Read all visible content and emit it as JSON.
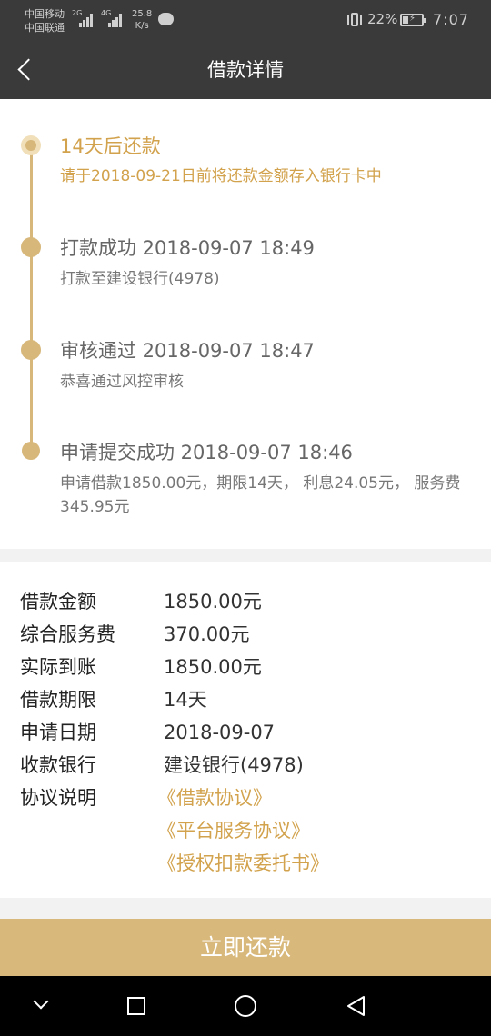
{
  "status_bar": {
    "carrier1": "中国移动",
    "carrier2": "中国联通",
    "net1": "2G",
    "net2": "4G",
    "speed_value": "25.8",
    "speed_unit": "K/s",
    "battery": "22%",
    "time": "7:07"
  },
  "header": {
    "title": "借款详情"
  },
  "timeline": [
    {
      "title": "14天后还款",
      "desc": "请于2018-09-21日前将还款金额存入银行卡中"
    },
    {
      "title": "打款成功 2018-09-07 18:49",
      "desc": "打款至建设银行(4978)"
    },
    {
      "title": "审核通过 2018-09-07 18:47",
      "desc": "恭喜通过风控审核"
    },
    {
      "title": "申请提交成功 2018-09-07 18:46",
      "desc": "申请借款1850.00元，期限14天， 利息24.05元， 服务费345.95元"
    }
  ],
  "details": [
    {
      "label": "借款金额",
      "value": "1850.00元"
    },
    {
      "label": "综合服务费",
      "value": "370.00元"
    },
    {
      "label": "实际到账",
      "value": "1850.00元"
    },
    {
      "label": "借款期限",
      "value": "14天"
    },
    {
      "label": "申请日期",
      "value": "2018-09-07"
    },
    {
      "label": "收款银行",
      "value": "建设银行(4978)"
    }
  ],
  "agreements": {
    "label": "协议说明",
    "links": [
      "《借款协议》",
      "《平台服务协议》",
      "《授权扣款委托书》"
    ]
  },
  "action": {
    "repay_label": "立即还款"
  },
  "colors": {
    "accent": "#d2a24c",
    "button": "#d8b97b",
    "header_bg": "#3a3a3a"
  }
}
